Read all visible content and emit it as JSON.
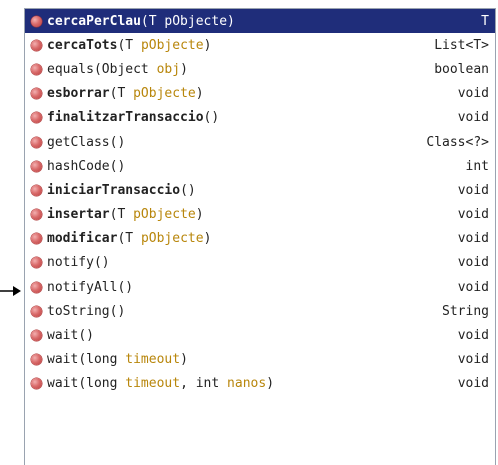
{
  "completion_popup": {
    "items": [
      {
        "name": "cercaPerClau",
        "bold": true,
        "params": [
          {
            "type": "T ",
            "name": "pObjecte"
          }
        ],
        "returns": "T",
        "selected": true
      },
      {
        "name": "cercaTots",
        "bold": true,
        "params": [
          {
            "type": "T ",
            "name": "pObjecte"
          }
        ],
        "returns": "List<T>",
        "selected": false
      },
      {
        "name": "equals",
        "bold": false,
        "params": [
          {
            "type": "Object ",
            "name": "obj"
          }
        ],
        "returns": "boolean",
        "selected": false
      },
      {
        "name": "esborrar",
        "bold": true,
        "params": [
          {
            "type": "T ",
            "name": "pObjecte"
          }
        ],
        "returns": "void",
        "selected": false
      },
      {
        "name": "finalitzarTransaccio",
        "bold": true,
        "params": [],
        "returns": "void",
        "selected": false
      },
      {
        "name": "getClass",
        "bold": false,
        "params": [],
        "returns": "Class<?>",
        "selected": false
      },
      {
        "name": "hashCode",
        "bold": false,
        "params": [],
        "returns": "int",
        "selected": false
      },
      {
        "name": "iniciarTransaccio",
        "bold": true,
        "params": [],
        "returns": "void",
        "selected": false
      },
      {
        "name": "insertar",
        "bold": true,
        "params": [
          {
            "type": "T ",
            "name": "pObjecte"
          }
        ],
        "returns": "void",
        "selected": false
      },
      {
        "name": "modificar",
        "bold": true,
        "params": [
          {
            "type": "T ",
            "name": "pObjecte"
          }
        ],
        "returns": "void",
        "selected": false
      },
      {
        "name": "notify",
        "bold": false,
        "params": [],
        "returns": "void",
        "selected": false
      },
      {
        "name": "notifyAll",
        "bold": false,
        "params": [],
        "returns": "void",
        "selected": false
      },
      {
        "name": "toString",
        "bold": false,
        "params": [],
        "returns": "String",
        "selected": false
      },
      {
        "name": "wait",
        "bold": false,
        "params": [],
        "returns": "void",
        "selected": false
      },
      {
        "name": "wait",
        "bold": false,
        "params": [
          {
            "type": "long ",
            "name": "timeout"
          }
        ],
        "returns": "void",
        "selected": false
      },
      {
        "name": "wait",
        "bold": false,
        "params": [
          {
            "type": "long ",
            "name": "timeout"
          },
          {
            "type": "int ",
            "name": "nanos"
          }
        ],
        "returns": "void",
        "selected": false
      }
    ]
  },
  "colors": {
    "selection_bg": "#1f2d7a",
    "param_name": "#b8860b",
    "method_icon": "#d96a6a"
  },
  "icons": {
    "method": "method-icon",
    "pointer": "arrow-pointer-icon"
  }
}
